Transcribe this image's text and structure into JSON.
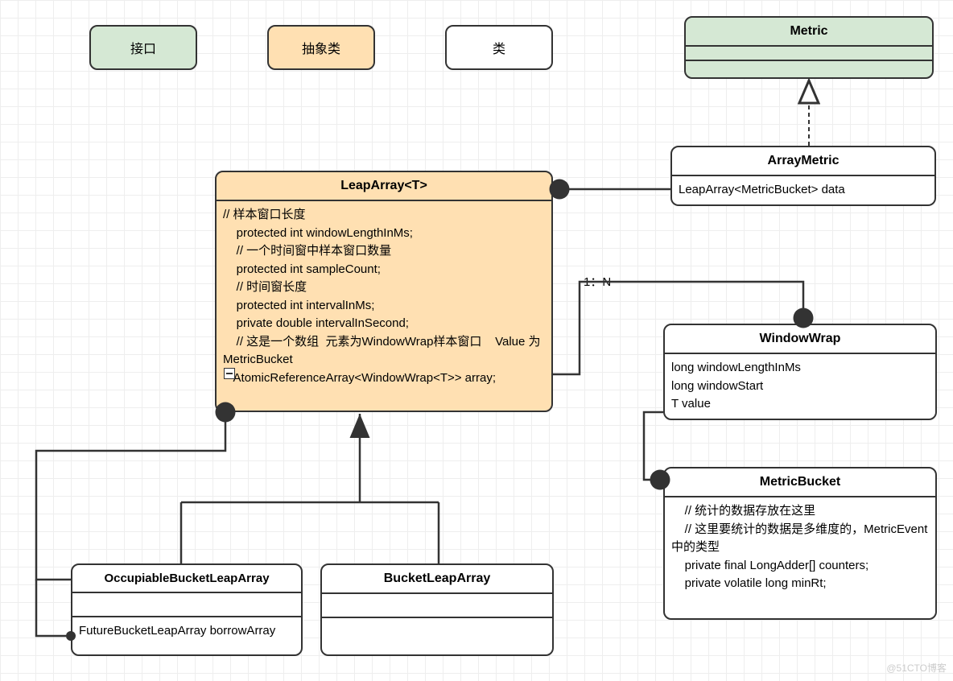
{
  "legend": {
    "interface": "接口",
    "abstract": "抽象类",
    "class": "类"
  },
  "metric": {
    "title": "Metric"
  },
  "arrayMetric": {
    "title": "ArrayMetric",
    "body": "LeapArray<MetricBucket> data"
  },
  "leapArray": {
    "title": "LeapArray<T>",
    "body": "// 样本窗口长度\n    protected int windowLengthInMs;\n    // 一个时间窗中样本窗口数量\n    protected int sampleCount;\n    // 时间窗长度\n    protected int intervalInMs;\n    private double intervalInSecond;\n    // 这是一个数组  元素为WindowWrap样本窗口    Value 为 MetricBucket\n   AtomicReferenceArray<WindowWrap<T>> array;"
  },
  "windowWrap": {
    "title": "WindowWrap",
    "body": "long windowLengthInMs\nlong windowStart\nT value"
  },
  "metricBucket": {
    "title": "MetricBucket",
    "body": "    // 统计的数据存放在这里\n    // 这里要统计的数据是多维度的，MetricEvent中的类型\n    private final LongAdder[] counters;\n    private volatile long minRt;"
  },
  "occupiableBucketLeapArray": {
    "title": "OccupiableBucketLeapArray",
    "body": "FutureBucketLeapArray borrowArray"
  },
  "bucketLeapArray": {
    "title": "BucketLeapArray"
  },
  "connectors": {
    "oneToN": "1：N"
  },
  "watermark": "@51CTO博客"
}
